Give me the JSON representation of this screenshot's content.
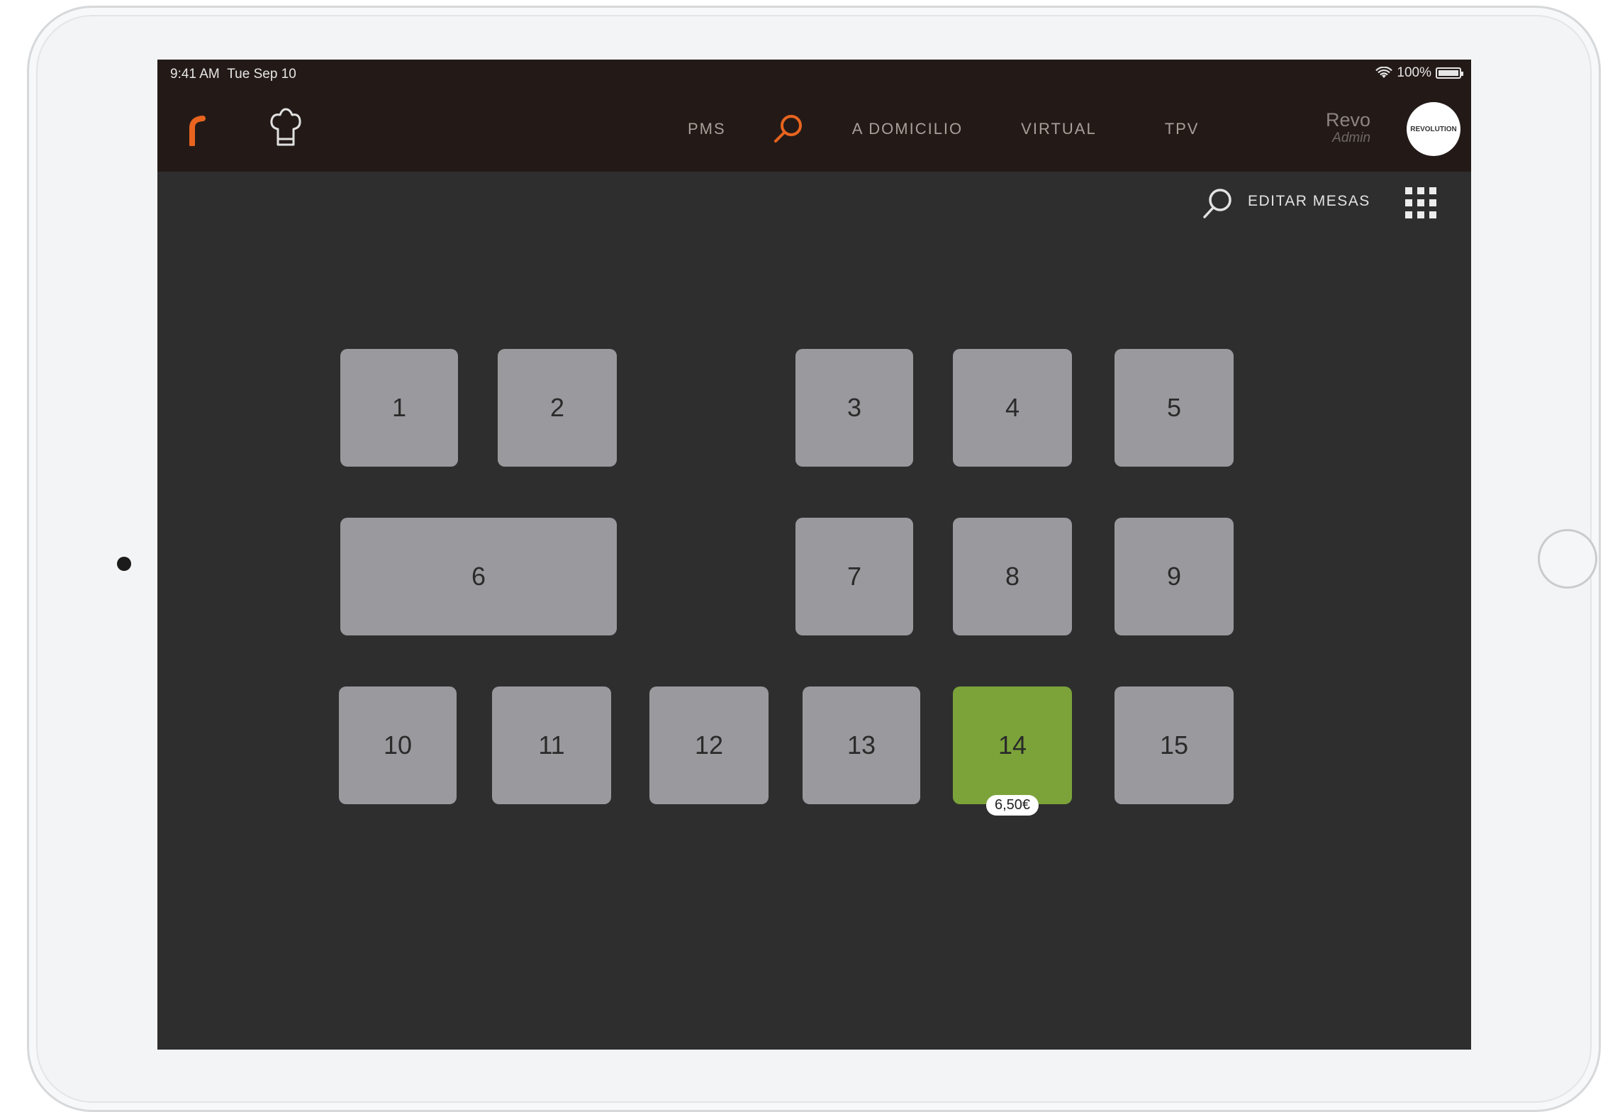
{
  "status_bar": {
    "time": "9:41 AM",
    "date": "Tue Sep 10",
    "battery": "100%"
  },
  "header": {
    "logo_icon": "revo-r-logo",
    "chef_icon": "chef-hat-icon",
    "nav": {
      "pms": "PMS",
      "search_icon": "search-icon",
      "domicilio": "A DOMICILIO",
      "virtual": "VIRTUAL",
      "tpv": "TPV"
    },
    "user": {
      "name": "Revo",
      "role": "Admin",
      "avatar_text": "REVOLUTION"
    }
  },
  "toolbar": {
    "search_icon": "search-icon",
    "edit_tables": "EDITAR MESAS",
    "grid_icon": "grid-icon"
  },
  "tables": {
    "t1": {
      "label": "1"
    },
    "t2": {
      "label": "2"
    },
    "t3": {
      "label": "3"
    },
    "t4": {
      "label": "4"
    },
    "t5": {
      "label": "5"
    },
    "t6": {
      "label": "6"
    },
    "t7": {
      "label": "7"
    },
    "t8": {
      "label": "8"
    },
    "t9": {
      "label": "9"
    },
    "t10": {
      "label": "10"
    },
    "t11": {
      "label": "11"
    },
    "t12": {
      "label": "12"
    },
    "t13": {
      "label": "13"
    },
    "t14": {
      "label": "14",
      "price": "6,50€",
      "status": "occupied"
    },
    "t15": {
      "label": "15"
    }
  },
  "colors": {
    "header_bg": "#231a17",
    "floor_bg": "#2e2e2e",
    "table_free": "#9a999e",
    "table_occupied": "#7ba33a",
    "accent": "#e8641f"
  }
}
